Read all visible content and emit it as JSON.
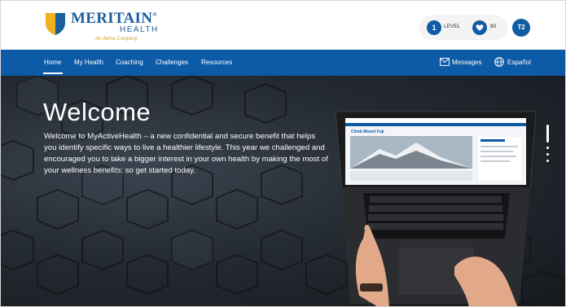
{
  "brand": {
    "name": "MERITAIN",
    "registered": "®",
    "subname": "HEALTH",
    "tagline": "An Aetna Company",
    "colors": {
      "primary": "#1d5f9e",
      "gold": "#c9a12a"
    }
  },
  "header": {
    "level": {
      "value": "1",
      "label": "LEVEL"
    },
    "points": {
      "value": "$0",
      "icon": "heart-icon"
    },
    "avatar_initials": "T2"
  },
  "nav": {
    "items": [
      {
        "label": "Home",
        "active": true
      },
      {
        "label": "My Health"
      },
      {
        "label": "Coaching"
      },
      {
        "label": "Challenges"
      },
      {
        "label": "Resources"
      }
    ],
    "messages": {
      "label": "Messages",
      "icon": "envelope-icon"
    },
    "language": {
      "label": "Español",
      "icon": "globe-icon"
    },
    "color": "#0d5aa7"
  },
  "hero": {
    "title": "Welcome",
    "text": "Welcome to MyActiveHealth – a new confidential and secure benefit that helps you identify specific ways to live a healthier lifestyle. This year we challenged and encouraged you to take a bigger interest in your own health by making the most of your wellness benefits; so get started today.",
    "screen_title": "Climb Mount Fuji"
  }
}
